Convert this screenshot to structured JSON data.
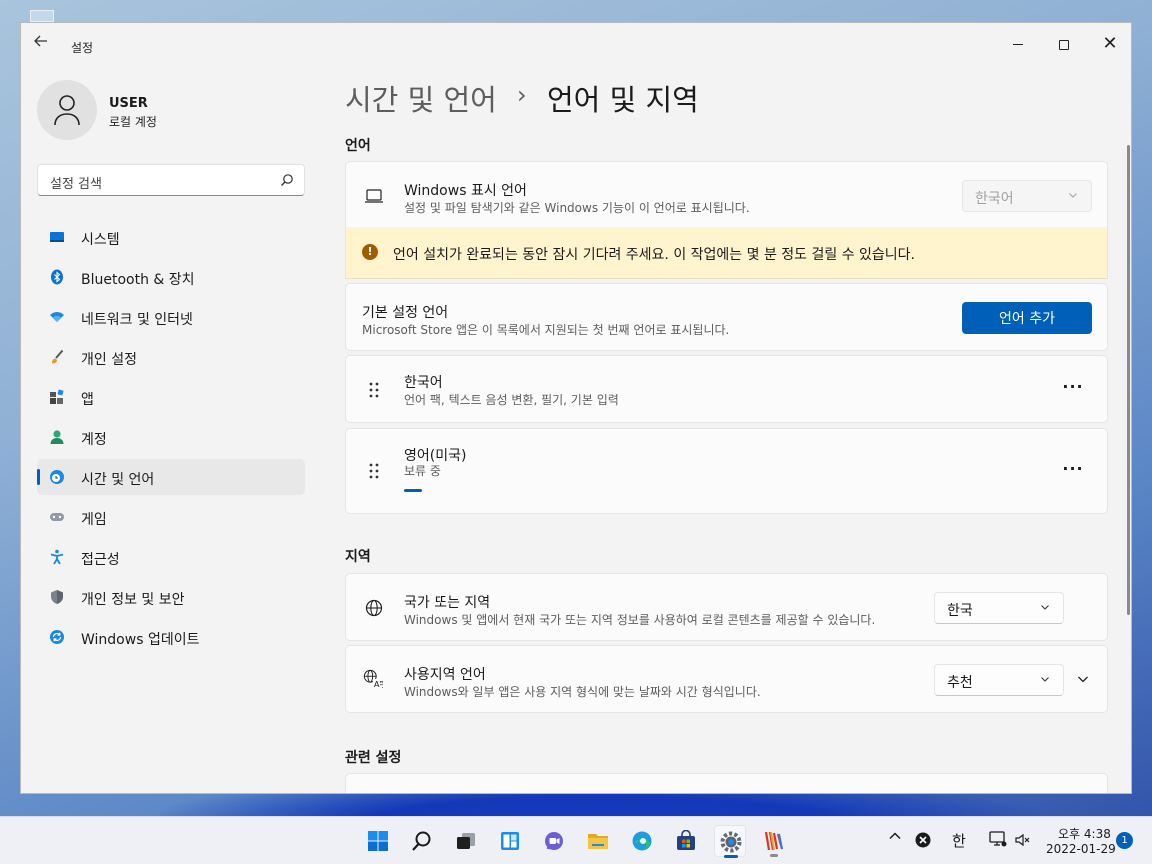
{
  "window": {
    "app_title": "설정",
    "controls": {
      "minimize_icon": "minimize-icon",
      "maximize_icon": "maximize-icon",
      "close_label": "✕"
    }
  },
  "user": {
    "name": "USER",
    "account_type": "로컬 계정"
  },
  "search": {
    "placeholder": "설정 검색"
  },
  "sidebar": {
    "items": [
      {
        "label": "시스템",
        "icon": "system-icon"
      },
      {
        "label": "Bluetooth & 장치",
        "icon": "bluetooth-icon"
      },
      {
        "label": "네트워크 및 인터넷",
        "icon": "wifi-icon"
      },
      {
        "label": "개인 설정",
        "icon": "brush-icon"
      },
      {
        "label": "앱",
        "icon": "apps-icon"
      },
      {
        "label": "계정",
        "icon": "account-icon"
      },
      {
        "label": "시간 및 언어",
        "icon": "time-language-icon",
        "active": true
      },
      {
        "label": "게임",
        "icon": "gamepad-icon"
      },
      {
        "label": "접근성",
        "icon": "accessibility-icon"
      },
      {
        "label": "개인 정보 및 보안",
        "icon": "shield-icon"
      },
      {
        "label": "Windows 업데이트",
        "icon": "update-icon"
      }
    ]
  },
  "breadcrumb": {
    "parent": "시간 및 언어",
    "separator": "›",
    "current": "언어 및 지역"
  },
  "language_section": {
    "title": "언어",
    "display_language": {
      "title": "Windows 표시 언어",
      "desc": "설정 및 파일 탐색기와 같은 Windows 기능이 이 언어로 표시됩니다.",
      "value": "한국어"
    },
    "warning": "언어 설치가 완료되는 동안 잠시 기다려 주세요. 이 작업에는 몇 분 정도 걸릴 수 있습니다.",
    "preferred": {
      "title": "기본 설정 언어",
      "desc": "Microsoft Store 앱은 이 목록에서 지원되는 첫 번째 언어로 표시됩니다.",
      "add_button": "언어 추가"
    },
    "languages": [
      {
        "name": "한국어",
        "desc": "언어 팩, 텍스트 음성 변환, 필기, 기본 입력"
      },
      {
        "name": "영어(미국)",
        "desc": "보류 중"
      }
    ],
    "more_label": "···"
  },
  "region_section": {
    "title": "지역",
    "country": {
      "title": "국가 또는 지역",
      "desc": "Windows 및 앱에서 현재 국가 또는 지역 정보를 사용하여 로컬 콘텐츠를 제공할 수 있습니다.",
      "value": "한국"
    },
    "regional_format": {
      "title": "사용지역 언어",
      "desc": "Windows와 일부 앱은 사용 지역 형식에 맞는 날짜와 시간 형식입니다.",
      "value": "추천"
    }
  },
  "related_section": {
    "title": "관련 설정"
  },
  "taskbar": {
    "apps": [
      "start-icon",
      "search-icon",
      "task-view-icon",
      "widgets-icon",
      "chat-icon",
      "file-explorer-icon",
      "edge-icon",
      "store-icon",
      "settings-icon",
      "app-icon"
    ],
    "tray": {
      "chevron": "^",
      "ime": "한"
    },
    "clock": {
      "time": "오후 4:38",
      "date": "2022-01-29"
    },
    "notifications": "1"
  },
  "colors": {
    "accent": "#005fb8",
    "warning_bg": "#fff4ce",
    "warning_icon": "#9d5d00"
  }
}
